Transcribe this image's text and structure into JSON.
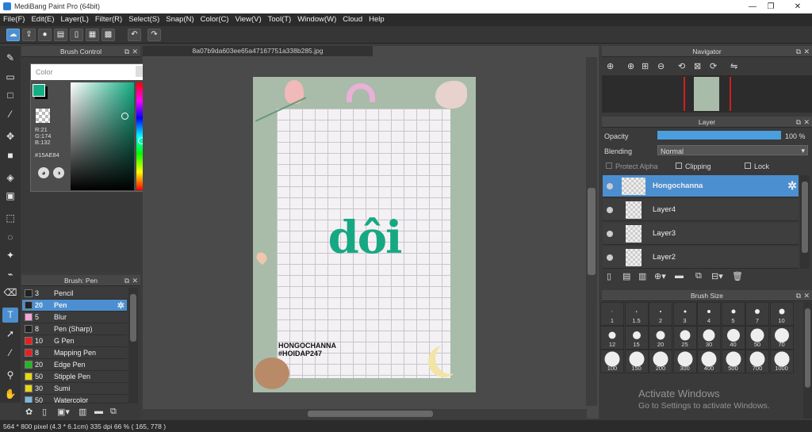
{
  "window": {
    "title": "MediBang Paint Pro (64bit)",
    "controls": [
      "—",
      "❐",
      "✕"
    ]
  },
  "menu": [
    "File(F)",
    "Edit(E)",
    "Layer(L)",
    "Filter(R)",
    "Select(S)",
    "Snap(N)",
    "Color(C)",
    "View(V)",
    "Tool(T)",
    "Window(W)",
    "Cloud",
    "Help"
  ],
  "toolbar_icons": [
    "cloud-icon",
    "share-icon",
    "chat-icon",
    "comment-icon",
    "page-icon",
    "grid-page-icon",
    "tiles-icon",
    "undo-icon",
    "redo-icon"
  ],
  "brush_control": {
    "title": "Brush Control"
  },
  "color_panel": {
    "title": "Color",
    "r": "R:21",
    "g": "G:174",
    "b": "B:132",
    "hex": "#15AE84",
    "primary": "#15ae84",
    "secondary": "#000000"
  },
  "brush_list": {
    "title": "Brush: Pen",
    "items": [
      {
        "size": "3",
        "name": "Pencil",
        "color": "#222222",
        "selected": false
      },
      {
        "size": "20",
        "name": "Pen",
        "color": "#222222",
        "selected": true
      },
      {
        "size": "5",
        "name": "Blur",
        "color": "#f4a6d8",
        "selected": false
      },
      {
        "size": "8",
        "name": "Pen (Sharp)",
        "color": "#222222",
        "selected": false
      },
      {
        "size": "10",
        "name": "G Pen",
        "color": "#e62020",
        "selected": false
      },
      {
        "size": "8",
        "name": "Mapping Pen",
        "color": "#e62020",
        "selected": false
      },
      {
        "size": "20",
        "name": "Edge Pen",
        "color": "#22b822",
        "selected": false
      },
      {
        "size": "50",
        "name": "Stipple Pen",
        "color": "#e8d810",
        "selected": false
      },
      {
        "size": "30",
        "name": "Sumi",
        "color": "#e8d810",
        "selected": false
      },
      {
        "size": "50",
        "name": "Watercolor",
        "color": "#7ab8e0",
        "selected": false
      }
    ]
  },
  "canvas": {
    "filename": "8a07b9da603ee65a47167751a338b285.jpg",
    "artwork_word": "dôi",
    "artwork_caption_1": "HONGOCHANNA",
    "artwork_caption_2": "#HOIDAP247"
  },
  "navigator": {
    "title": "Navigator"
  },
  "layer_panel": {
    "title": "Layer",
    "opacity_label": "Opacity",
    "opacity_value": "100 %",
    "opacity_fraction": 1.0,
    "blending_label": "Blending",
    "blending_value": "Normal",
    "protect_alpha": "Protect Alpha",
    "clipping": "Clipping",
    "lock": "Lock",
    "layers": [
      {
        "name": "Hongochanna",
        "selected": true
      },
      {
        "name": "Layer4",
        "selected": false
      },
      {
        "name": "Layer3",
        "selected": false
      },
      {
        "name": "Layer2",
        "selected": false
      }
    ]
  },
  "brush_size": {
    "title": "Brush Size",
    "sizes": [
      "1",
      "1.5",
      "2",
      "3",
      "4",
      "5",
      "7",
      "10",
      "12",
      "15",
      "20",
      "25",
      "30",
      "40",
      "50",
      "70",
      "100",
      "150",
      "200",
      "300",
      "400",
      "500",
      "700",
      "1000"
    ]
  },
  "watermark": {
    "line1": "Activate Windows",
    "line2": "Go to Settings to activate Windows."
  },
  "status": "564 * 800 pixel   (4.3 * 6.1cm)   335 dpi   66 %   ( 165, 778 )"
}
